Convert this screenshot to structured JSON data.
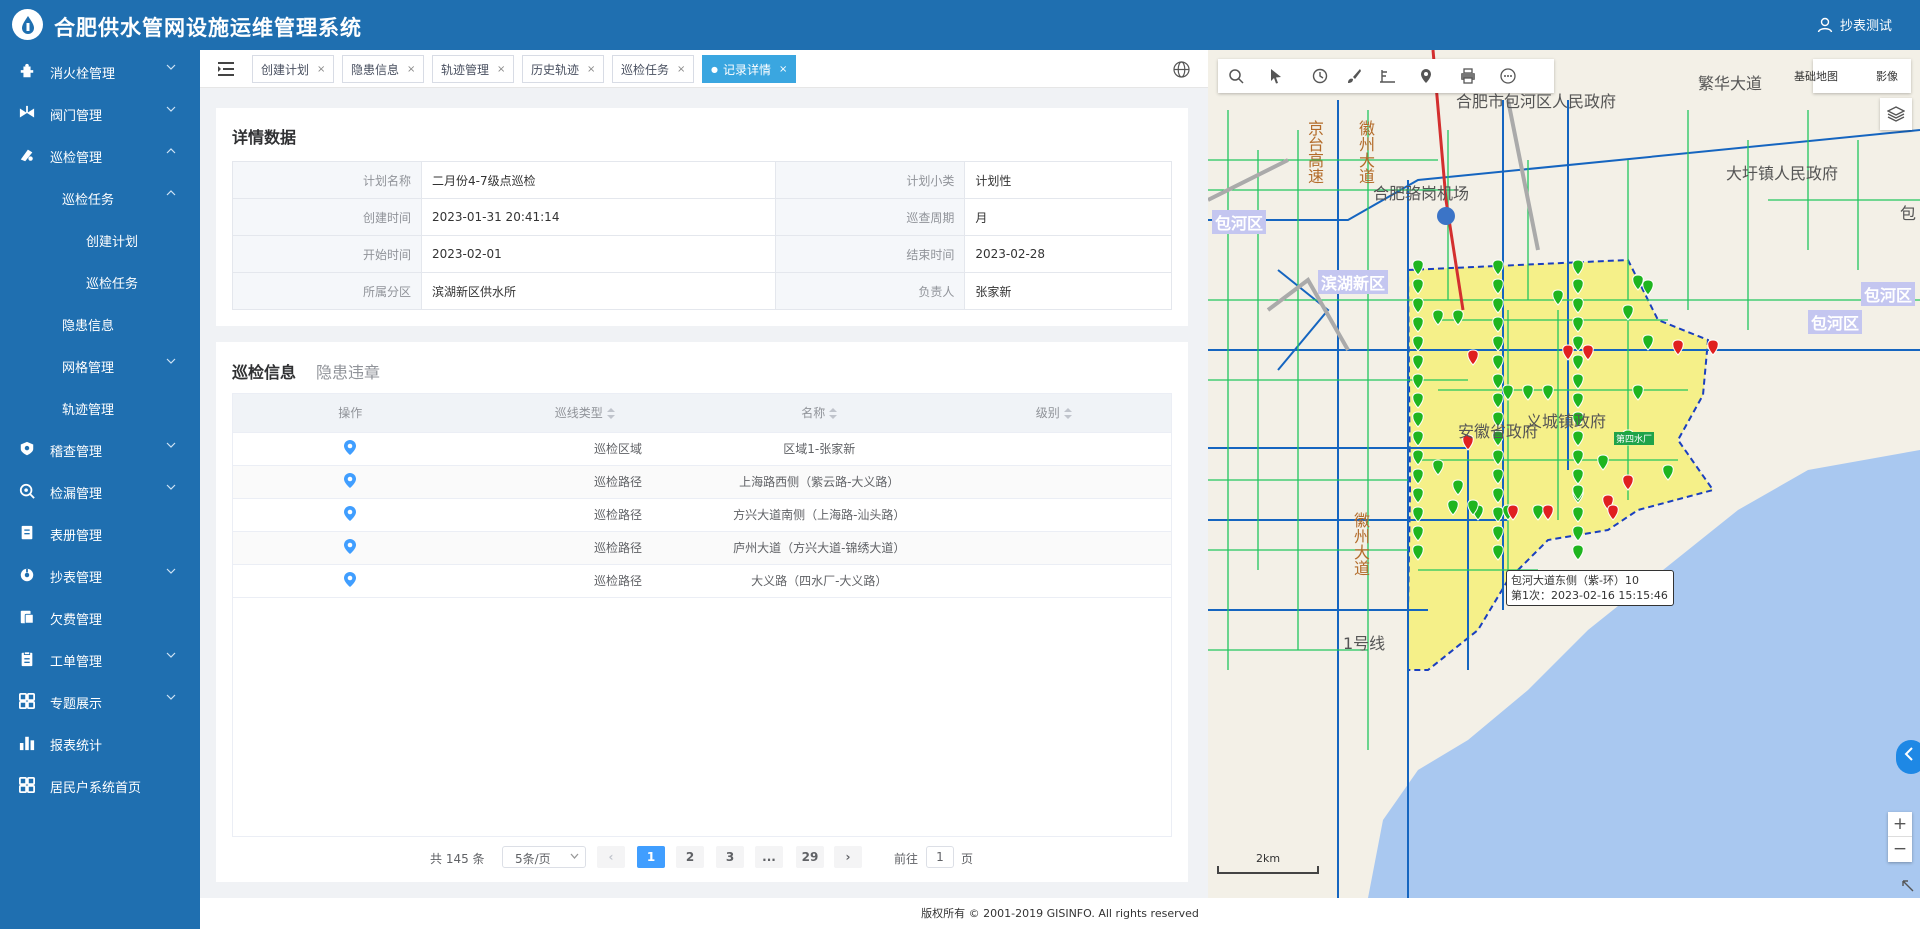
{
  "app": {
    "title": "合肥供水管网设施运维管理系统",
    "user": "抄表测试"
  },
  "sidebar": {
    "items": [
      {
        "label": "消火栓管理",
        "icon": "hydrant-icon",
        "chevron": "down"
      },
      {
        "label": "阀门管理",
        "icon": "valve-icon",
        "chevron": "down"
      },
      {
        "label": "巡检管理",
        "icon": "inspection-icon",
        "chevron": "up"
      },
      {
        "label": "巡检任务",
        "icon": "",
        "chevron": "up"
      },
      {
        "label": "创建计划",
        "icon": "",
        "chevron": ""
      },
      {
        "label": "巡检任务",
        "icon": "",
        "chevron": ""
      },
      {
        "label": "隐患信息",
        "icon": "",
        "chevron": ""
      },
      {
        "label": "网格管理",
        "icon": "",
        "chevron": "down"
      },
      {
        "label": "轨迹管理",
        "icon": "",
        "chevron": ""
      },
      {
        "label": "稽查管理",
        "icon": "audit-icon",
        "chevron": "down"
      },
      {
        "label": "检漏管理",
        "icon": "leak-detect-icon",
        "chevron": "down"
      },
      {
        "label": "表册管理",
        "icon": "register-icon",
        "chevron": ""
      },
      {
        "label": "抄表管理",
        "icon": "meter-reading-icon",
        "chevron": "down"
      },
      {
        "label": "欠费管理",
        "icon": "arrears-icon",
        "chevron": ""
      },
      {
        "label": "工单管理",
        "icon": "work-order-icon",
        "chevron": "down"
      },
      {
        "label": "专题展示",
        "icon": "topic-icon",
        "chevron": "down"
      },
      {
        "label": "报表统计",
        "icon": "chart-bar-icon",
        "chevron": ""
      },
      {
        "label": "居民户系统首页",
        "icon": "home-grid-icon",
        "chevron": ""
      }
    ]
  },
  "tabs": [
    {
      "label": "创建计划",
      "active": false
    },
    {
      "label": "隐患信息",
      "active": false
    },
    {
      "label": "轨迹管理",
      "active": false
    },
    {
      "label": "历史轨迹",
      "active": false
    },
    {
      "label": "巡检任务",
      "active": false
    },
    {
      "label": "记录详情",
      "active": true
    }
  ],
  "details": {
    "title": "详情数据",
    "rows": [
      [
        {
          "k": "计划名称",
          "v": "二月份4-7级点巡检"
        },
        {
          "k": "计划小类",
          "v": "计划性"
        }
      ],
      [
        {
          "k": "创建时间",
          "v": "2023-01-31 20:41:14"
        },
        {
          "k": "巡查周期",
          "v": "月"
        }
      ],
      [
        {
          "k": "开始时间",
          "v": "2023-02-01"
        },
        {
          "k": "结束时间",
          "v": "2023-02-28"
        }
      ],
      [
        {
          "k": "所属分区",
          "v": "滨湖新区供水所"
        },
        {
          "k": "负责人",
          "v": "张家新"
        }
      ]
    ]
  },
  "info": {
    "tab_active": "巡检信息",
    "tab_inactive": "隐患违章",
    "columns": [
      "操作",
      "巡线类型",
      "名称",
      "级别"
    ],
    "rows": [
      {
        "type": "巡检区域",
        "name": "区域1-张家新",
        "level": ""
      },
      {
        "type": "巡检路径",
        "name": "上海路西侧（紫云路-大义路）",
        "level": ""
      },
      {
        "type": "巡检路径",
        "name": "方兴大道南侧（上海路-汕头路）",
        "level": ""
      },
      {
        "type": "巡检路径",
        "name": "庐州大道（方兴大道-锦绣大道）",
        "level": ""
      },
      {
        "type": "巡检路径",
        "name": "大义路（四水厂-大义路）",
        "level": ""
      }
    ]
  },
  "pager": {
    "total": "共 145 条",
    "page_size": "5条/页",
    "pages": [
      "1",
      "2",
      "3",
      "...",
      "29"
    ],
    "current": "1",
    "goto_label": "前往",
    "goto_value": "1",
    "page_unit": "页"
  },
  "map": {
    "basemap_label": "基础地图",
    "imagery_label": "影像",
    "scale_label": "2km",
    "zoom_in": "+",
    "zoom_out": "−",
    "tooltip_line1": "包河大道东侧（紫-环）10",
    "tooltip_line2": "第1次：2023-02-16 15:15:46",
    "place_labels": [
      "合肥市包河区人民政府",
      "繁华大道",
      "京台高速",
      "徽州大道",
      "合肥骆岗机场",
      "大圩镇人民政府",
      "滨湖新区",
      "包河区",
      "包河区",
      "义城镇政府",
      "安徽省政府",
      "第四水厂",
      "徽州大道",
      "1号线",
      "包河区",
      "包"
    ],
    "colors": {
      "pipe_blue": "#1565c0",
      "pipe_green": "#22c55e",
      "zone_fill": "#f6f06a",
      "lake": "#a9c8f0",
      "marker_green": "#1fb51f",
      "marker_red": "#e02020"
    }
  },
  "footer": "版权所有 © 2001-2019 GISINFO. All rights reserved"
}
